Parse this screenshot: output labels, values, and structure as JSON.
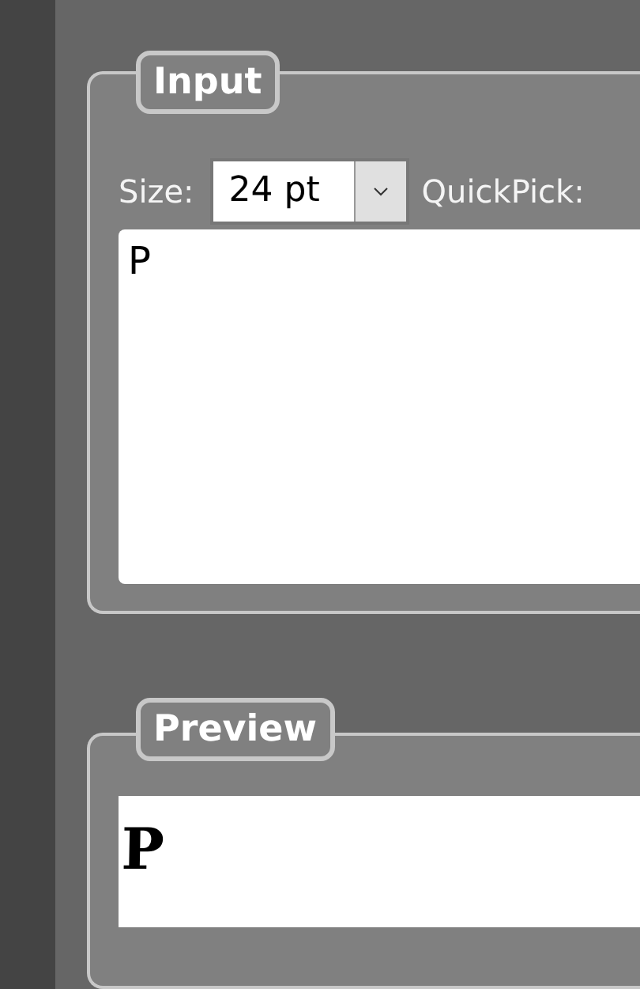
{
  "input_group": {
    "title": "Input",
    "size_label": "Size:",
    "size_value": "24 pt",
    "quickpick_label": "QuickPick:",
    "text": "P"
  },
  "preview_group": {
    "title": "Preview",
    "text": "P"
  }
}
